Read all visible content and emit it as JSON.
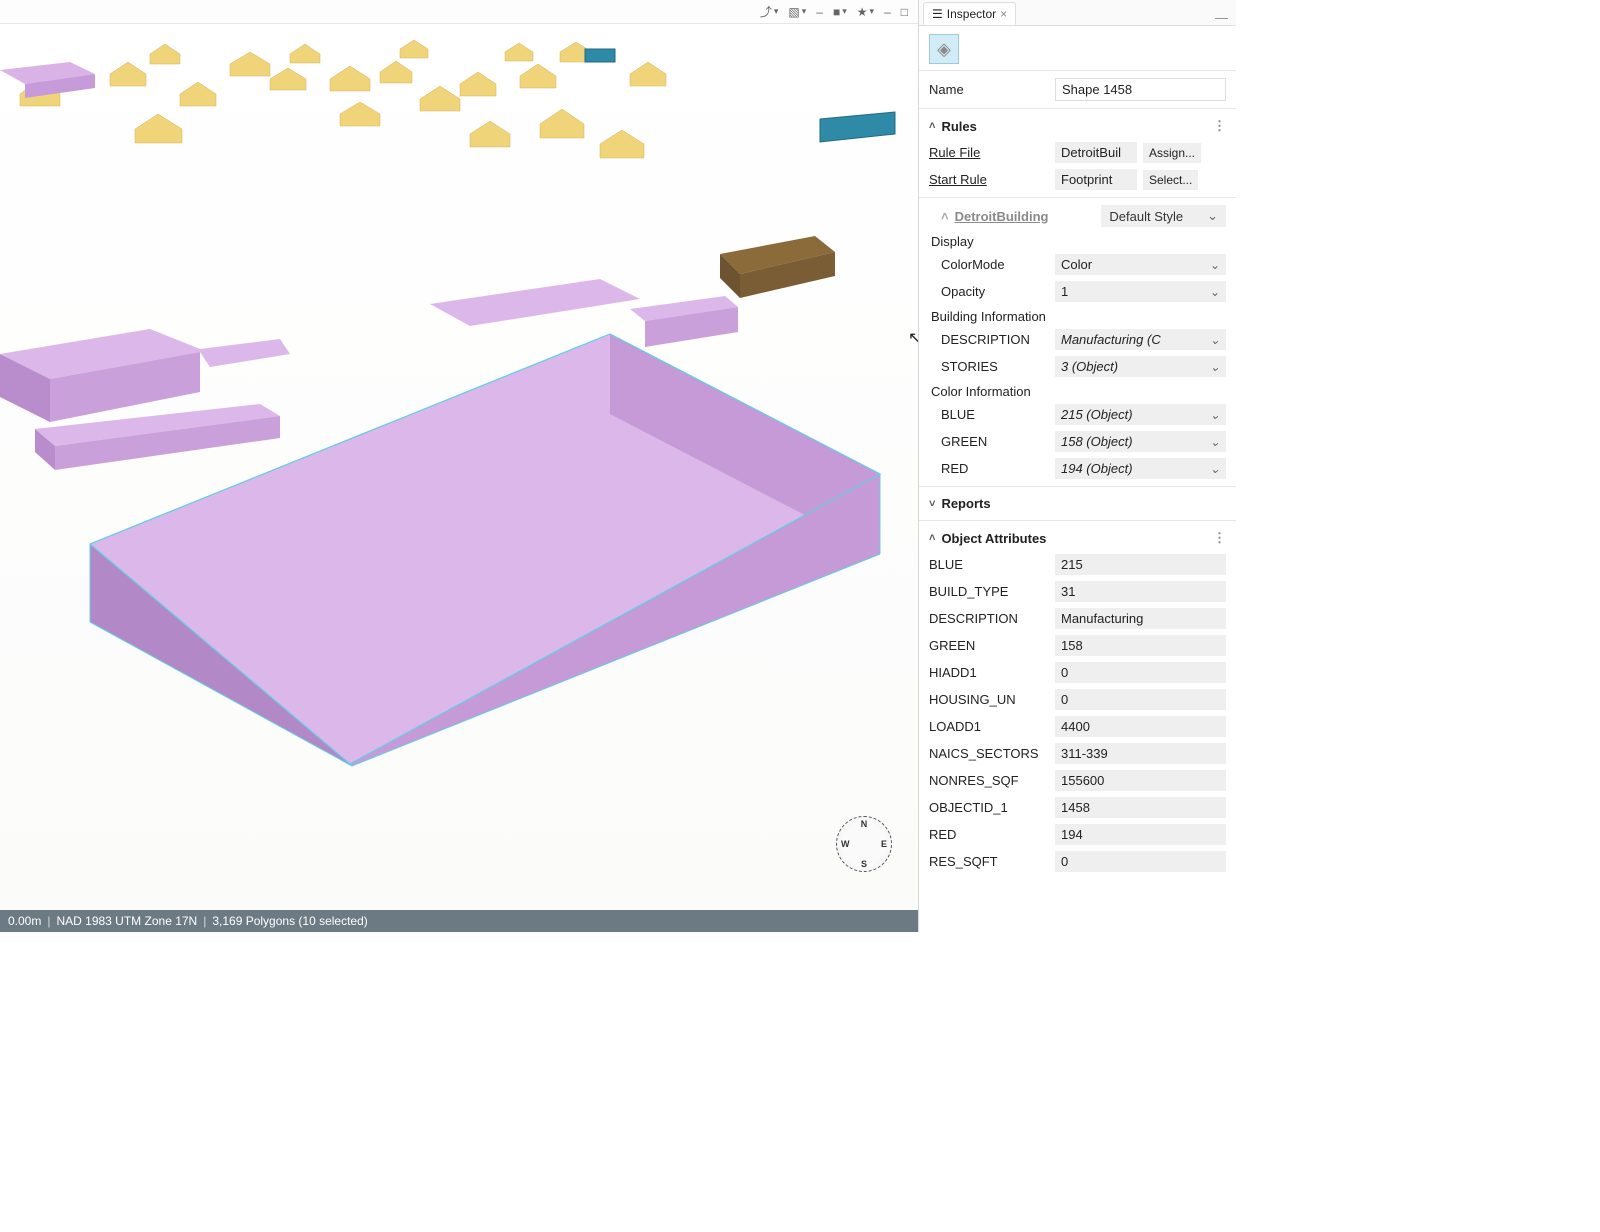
{
  "tab": {
    "title": "Inspector"
  },
  "name_field": {
    "label": "Name",
    "value": "Shape 1458"
  },
  "rules": {
    "header": "Rules",
    "rule_file_label": "Rule File",
    "rule_file_value": "DetroitBuil",
    "rule_file_btn": "Assign...",
    "start_rule_label": "Start Rule",
    "start_rule_value": "Footprint",
    "start_rule_btn": "Select..."
  },
  "detroit": {
    "header": "DetroitBuilding",
    "style": "Default Style",
    "display_label": "Display",
    "colormode_label": "ColorMode",
    "colormode_value": "Color",
    "opacity_label": "Opacity",
    "opacity_value": "1",
    "building_info_label": "Building Information",
    "description_label": "DESCRIPTION",
    "description_value": "Manufacturing (C",
    "stories_label": "STORIES",
    "stories_value": "3 (Object)",
    "color_info_label": "Color Information",
    "blue_label": "BLUE",
    "blue_value": "215 (Object)",
    "green_label": "GREEN",
    "green_value": "158 (Object)",
    "red_label": "RED",
    "red_value": "194 (Object)"
  },
  "reports": {
    "header": "Reports"
  },
  "obj_attrs": {
    "header": "Object Attributes",
    "rows": {
      "blue": {
        "k": "BLUE",
        "v": "215"
      },
      "build_type": {
        "k": "BUILD_TYPE",
        "v": "31"
      },
      "description": {
        "k": "DESCRIPTION",
        "v": "Manufacturing"
      },
      "green": {
        "k": "GREEN",
        "v": "158"
      },
      "hiadd1": {
        "k": "HIADD1",
        "v": "0"
      },
      "housing_un": {
        "k": "HOUSING_UN",
        "v": "0"
      },
      "loadd1": {
        "k": "LOADD1",
        "v": "4400"
      },
      "naics": {
        "k": "NAICS_SECTORS",
        "v": "311-339"
      },
      "nonres_sqf": {
        "k": "NONRES_SQF",
        "v": "155600"
      },
      "objectid": {
        "k": "OBJECTID_1",
        "v": "1458"
      },
      "red": {
        "k": "RED",
        "v": "194"
      },
      "res_sqft": {
        "k": "RES_SQFT",
        "v": "0"
      }
    }
  },
  "status": {
    "range": "0.00m",
    "crs": "NAD 1983 UTM Zone 17N",
    "polys": "3,169 Polygons  (10 selected)"
  }
}
